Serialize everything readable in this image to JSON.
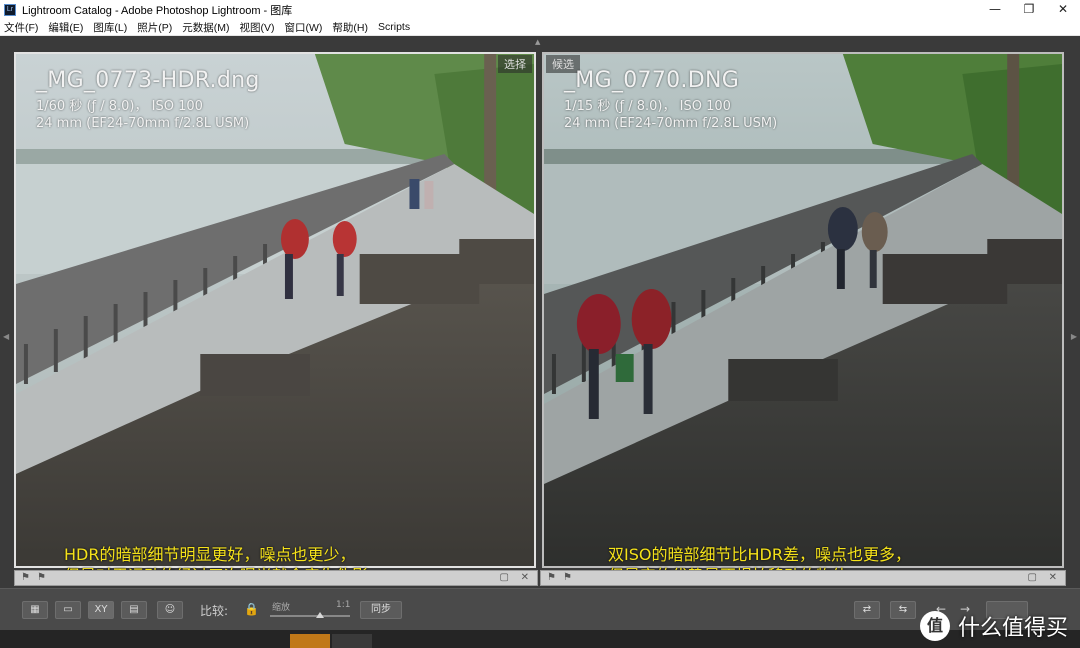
{
  "window": {
    "app_icon": "Lr",
    "title": "Lightroom Catalog - Adobe Photoshop Lightroom - 图库",
    "controls": {
      "minimize": "—",
      "maximize": "❐",
      "close": "✕"
    }
  },
  "menu": [
    "文件(F)",
    "编辑(E)",
    "图库(L)",
    "照片(P)",
    "元数据(M)",
    "视图(V)",
    "窗口(W)",
    "帮助(H)",
    "Scripts"
  ],
  "left_panel": {
    "tag": "选择",
    "filename": "_MG_0773-HDR.dng",
    "exposure": "1/60 秒 (ƒ / 8.0)， ISO 100",
    "lens": "24 mm (EF24-70mm f/2.8L USM)",
    "caption_line1": "HDR的暗部细节明显更好，噪点也更少，",
    "caption_line2": "但是对于运动的经过三次曝光就会产生伪影"
  },
  "right_panel": {
    "tag": "候选",
    "filename": "_MG_0770.DNG",
    "exposure": "1/15 秒 (ƒ / 8.0)， ISO 100",
    "lens": "24 mm (EF24-70mm f/2.8L USM)",
    "caption_line1": "双ISO的暗部细节比HDR差，噪点也更多，",
    "caption_line2": "但是它的优势是不惧怕移动的物体。"
  },
  "toolbar": {
    "compare_label": "比较:",
    "zoom_label": "缩放",
    "zoom_value": "1:1",
    "zoom_fraction": 0.62,
    "sync_button": "同步",
    "xy_button": "XY"
  },
  "watermark": {
    "logo": "值",
    "text": "什么值得买"
  },
  "icons": [
    "grid-icon",
    "loupe-icon",
    "compare-icon",
    "survey-icon",
    "people-icon",
    "lock-icon",
    "swap-icon",
    "flag-icon",
    "close-icon"
  ]
}
